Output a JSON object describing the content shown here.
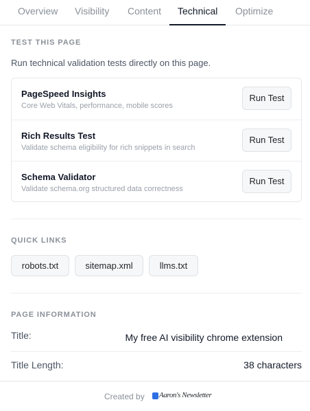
{
  "tabs": [
    {
      "label": "Overview",
      "active": false
    },
    {
      "label": "Visibility",
      "active": false
    },
    {
      "label": "Content",
      "active": false
    },
    {
      "label": "Technical",
      "active": true
    },
    {
      "label": "Optimize",
      "active": false
    }
  ],
  "test_section": {
    "title": "TEST THIS PAGE",
    "description": "Run technical validation tests directly on this page.",
    "tests": [
      {
        "name": "PageSpeed Insights",
        "description": "Core Web Vitals, performance, mobile scores",
        "button": "Run Test"
      },
      {
        "name": "Rich Results Test",
        "description": "Validate schema eligibility for rich snippets in search",
        "button": "Run Test"
      },
      {
        "name": "Schema Validator",
        "description": "Validate schema.org structured data correctness",
        "button": "Run Test"
      }
    ]
  },
  "quick_links": {
    "title": "QUICK LINKS",
    "links": [
      "robots.txt",
      "sitemap.xml",
      "llms.txt"
    ]
  },
  "page_info": {
    "title": "PAGE INFORMATION",
    "rows": [
      {
        "label": "Title:",
        "value": "My free AI visibility chrome extension"
      },
      {
        "label": "Title Length:",
        "value": "38 characters"
      }
    ]
  },
  "footer": {
    "created_by": "Created by",
    "brand": "Aaron's Newsletter",
    "brand_color": "#2f6fe4"
  }
}
